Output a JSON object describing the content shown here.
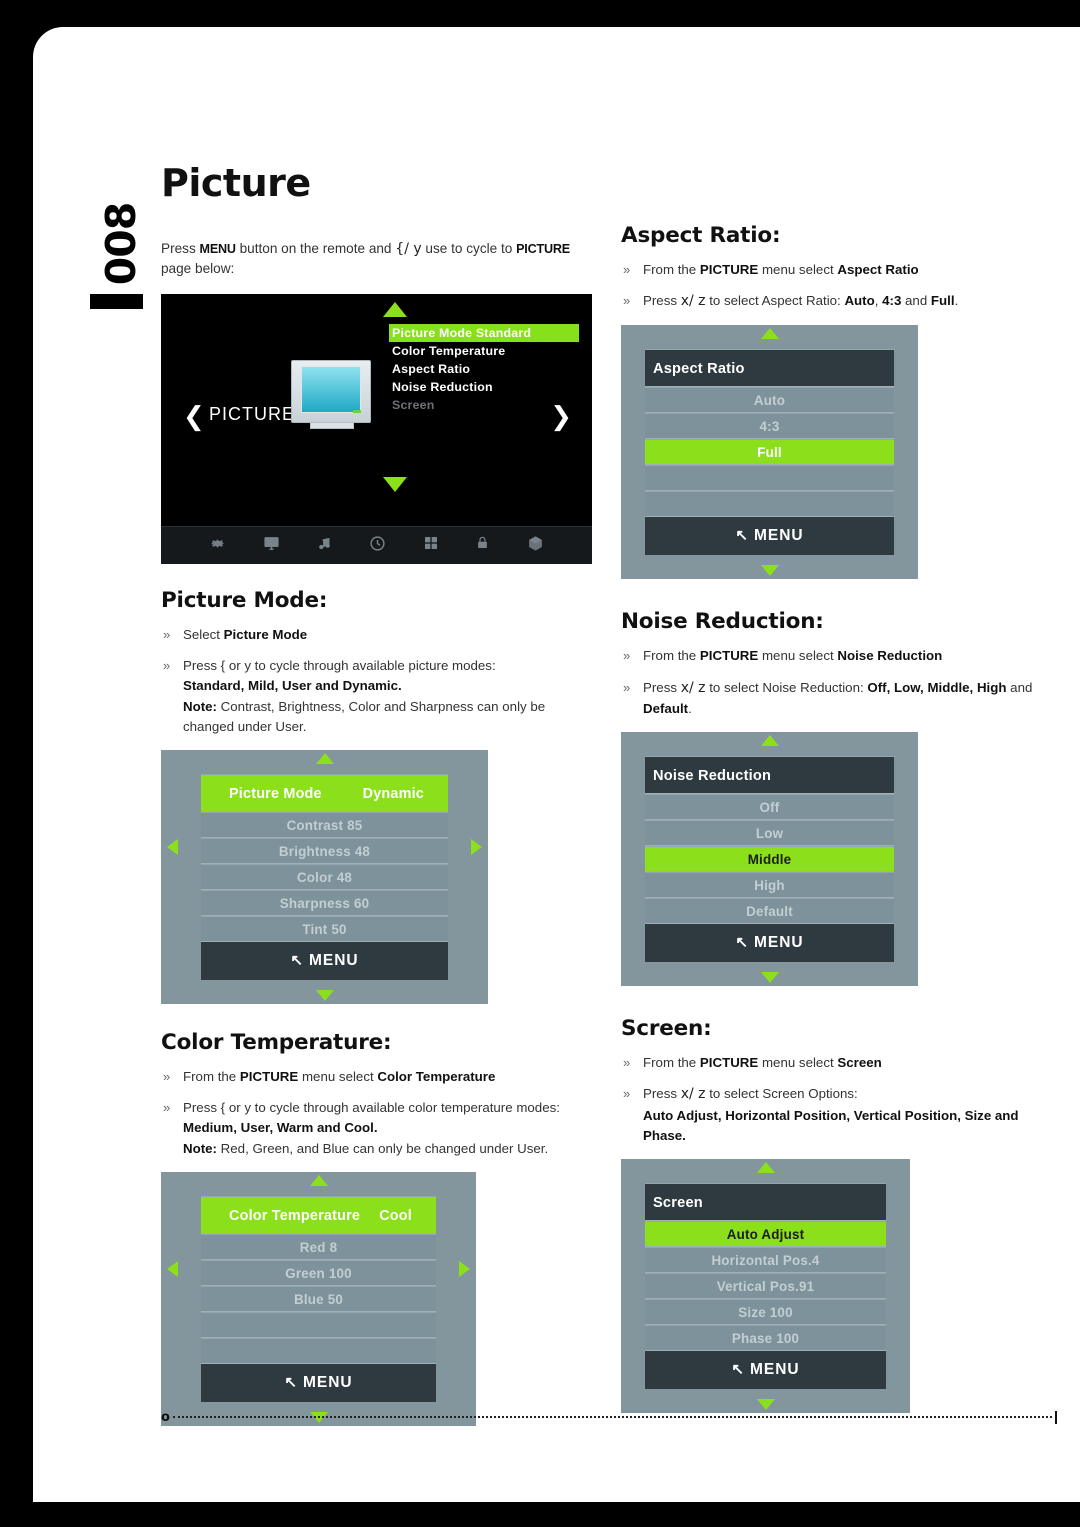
{
  "page": {
    "number": "008",
    "title": "Picture"
  },
  "intro": {
    "pre": "Press ",
    "menu_key": "MENU",
    "mid": " button on the remote and ",
    "nav_syms": "{/ y",
    "mid2": " use to cycle to ",
    "picture_key": "PICTURE",
    "post": " page below:"
  },
  "main_osd": {
    "category_label": "PICTURE",
    "left_chevron": "❮",
    "right_chevron": "❯",
    "items": [
      {
        "label": "Picture Mode Standard",
        "state": "highlighted"
      },
      {
        "label": "Color  Temperature",
        "state": "normal"
      },
      {
        "label": "Aspect  Ratio",
        "state": "normal"
      },
      {
        "label": "Noise  Reduction",
        "state": "normal"
      },
      {
        "label": "Screen",
        "state": "dim"
      }
    ],
    "icon_bar": [
      "gear-icon",
      "monitor-icon",
      "music-note-icon",
      "clock-icon",
      "grid-icon",
      "lock-icon",
      "box-icon"
    ]
  },
  "sections": {
    "picture_mode": {
      "heading": "Picture Mode:",
      "bullets": [
        {
          "text": "Select ",
          "bold_tail": "Picture Mode"
        },
        {
          "text": "Press  { or  y to cycle through available picture modes:",
          "line2": "Standard, Mild, User and Dynamic.",
          "note_label": "Note:",
          "note": " Contrast, Brightness, Color and Sharpness can only be changed under User."
        }
      ],
      "panel": {
        "title": "Picture Mode",
        "value": "Dynamic",
        "rows": [
          "Contrast  85",
          "Brightness 48",
          "Color  48",
          "Sharpness  60",
          "Tint  50"
        ],
        "menu_label": "MENU"
      }
    },
    "color_temperature": {
      "heading": "Color Temperature:",
      "bullets": [
        {
          "text": "From the PICTURE menu select Color Temperature"
        },
        {
          "text": "Press  { or  y to cycle through available color temperature modes:",
          "line2": "Medium, User, Warm and Cool.",
          "note_label": "Note:",
          "note": " Red, Green, and Blue can only be changed under User."
        }
      ],
      "panel": {
        "title": "Color Temperature",
        "value": "Cool",
        "rows": [
          "Red 8",
          "Green 100",
          "Blue 50",
          "",
          ""
        ],
        "menu_label": "MENU"
      }
    },
    "aspect_ratio": {
      "heading": "Aspect Ratio:",
      "bullets": [
        {
          "text": "From the PICTURE menu select Aspect Ratio"
        },
        {
          "text": "Press  x/ z to select Aspect Ratio: Auto, 4:3 and Full."
        }
      ],
      "panel": {
        "header": "Aspect  Ratio",
        "rows": [
          {
            "label": "Auto",
            "selected": false
          },
          {
            "label": "4:3",
            "selected": false
          },
          {
            "label": "Full",
            "selected": true
          },
          {
            "label": "",
            "selected": false
          },
          {
            "label": "",
            "selected": false
          }
        ],
        "menu_label": "MENU"
      }
    },
    "noise_reduction": {
      "heading": "Noise Reduction:",
      "bullets": [
        {
          "text": "From the PICTURE menu select Noise Reduction"
        },
        {
          "text": "Press  x/ z to select Noise Reduction: Off, Low, Middle, High and Default."
        }
      ],
      "panel": {
        "header": "Noise Reduction",
        "rows": [
          {
            "label": "Off",
            "selected": false
          },
          {
            "label": "Low",
            "selected": false
          },
          {
            "label": "Middle",
            "selected": true
          },
          {
            "label": "High",
            "selected": false
          },
          {
            "label": "Default",
            "selected": false
          }
        ],
        "menu_label": "MENU"
      }
    },
    "screen": {
      "heading": "Screen:",
      "bullets": [
        {
          "text": "From the PICTURE menu select Screen"
        },
        {
          "text": "Press  x/ z to select Screen Options:",
          "line2": "Auto Adjust, Horizontal Position, Vertical Position, Size and Phase."
        }
      ],
      "panel": {
        "header": "Screen",
        "rows": [
          {
            "label": "Auto Adjust",
            "selected": true
          },
          {
            "label": "Horizontal Pos.4",
            "selected": false
          },
          {
            "label": "Vertical Pos.91",
            "selected": false
          },
          {
            "label": "Size 100",
            "selected": false
          },
          {
            "label": "Phase 100",
            "selected": false
          }
        ],
        "menu_label": "MENU"
      }
    }
  },
  "footer": {
    "start_mark": "o",
    "end_mark": "|"
  },
  "colors": {
    "highlight_green": "#8ce01b",
    "panel_bg": "#83959d",
    "row_bg": "#7d929b",
    "dark_row": "#2e3a40"
  }
}
